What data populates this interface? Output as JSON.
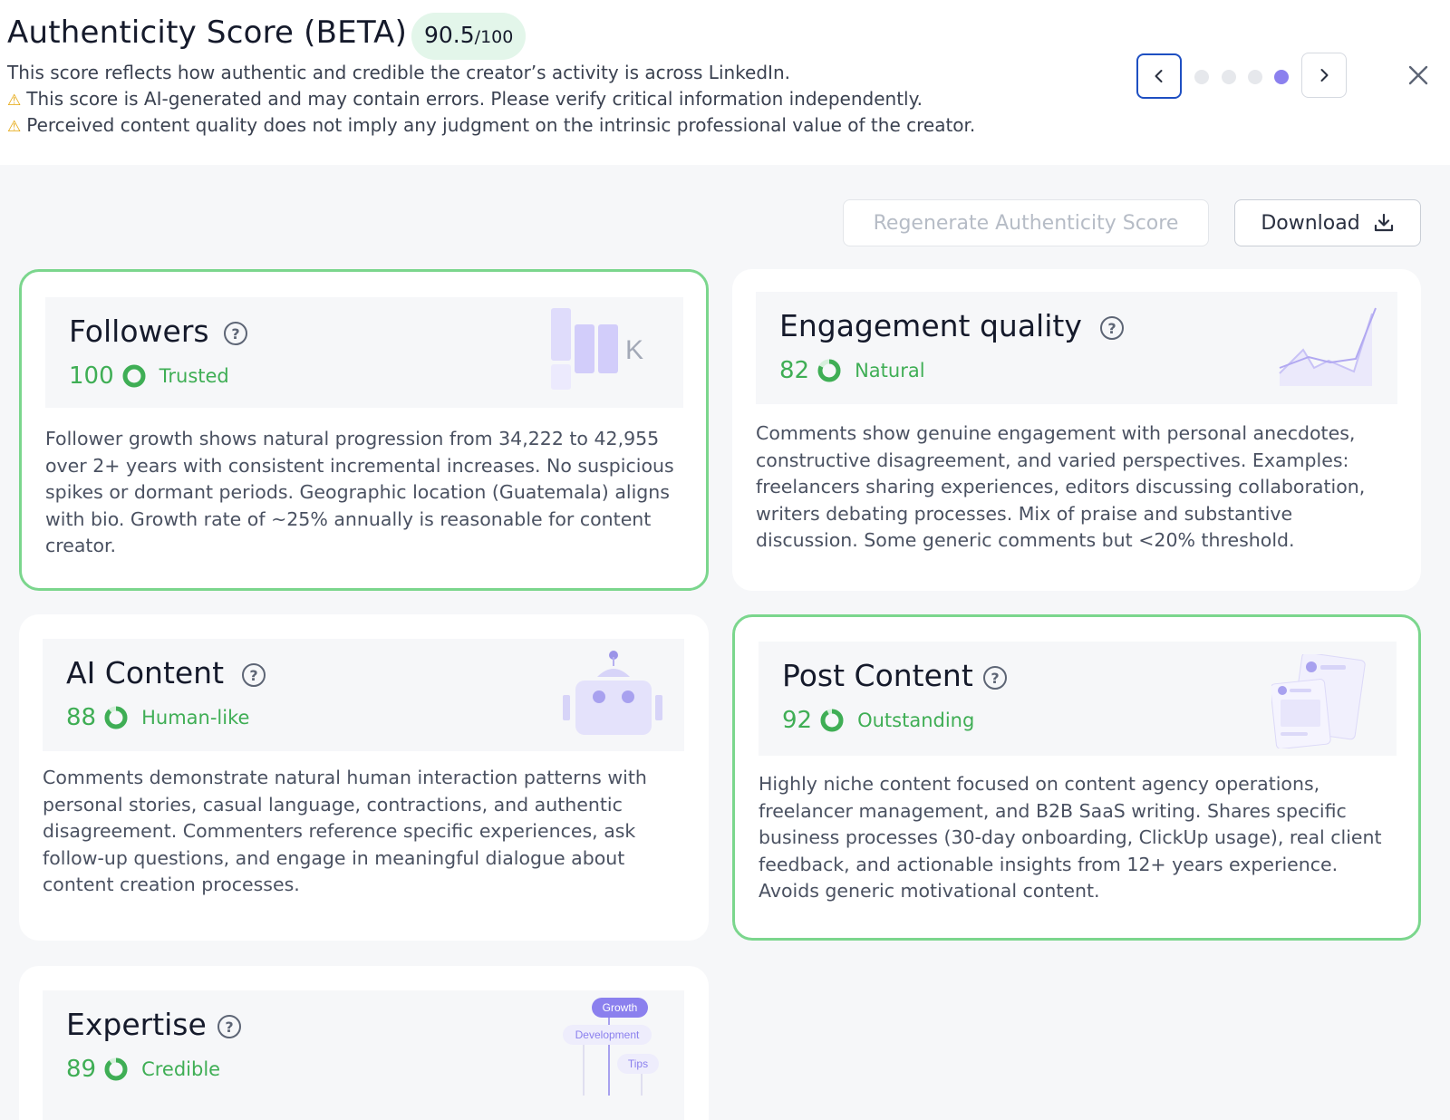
{
  "header": {
    "title": "Authenticity Score (BETA)",
    "score": "90.5",
    "score_max": "/100",
    "line1": "This score reflects how authentic and credible the creator’s activity is across LinkedIn.",
    "line2": "This score is AI-generated and may contain errors. Please verify critical information independently.",
    "line3": "Perceived content quality does not imply any judgment on the intrinsic professional value of the creator.",
    "pagination": {
      "total": 4,
      "active": 4
    }
  },
  "actions": {
    "regenerate_label": "Regenerate Authenticity Score",
    "download_label": "Download"
  },
  "cards": [
    {
      "title": "Followers",
      "score": "100",
      "score_value": 100,
      "label": "Trusted",
      "illustration_letter": "K",
      "description": "Follower growth shows natural progression from 34,222 to 42,955 over 2+ years with consistent incremental increases. No suspicious spikes or dormant periods. Geographic location (Guatemala) aligns with bio. Growth rate of ~25% annually is reasonable for content creator."
    },
    {
      "title": "Engagement quality",
      "score": "82",
      "score_value": 82,
      "label": "Natural",
      "description": "Comments show genuine engagement with personal anecdotes, constructive disagreement, and varied perspectives. Examples: freelancers sharing experiences, editors discussing collaboration, writers debating processes. Mix of praise and substantive discussion. Some generic comments but <20% threshold."
    },
    {
      "title": "AI Content",
      "score": "88",
      "score_value": 88,
      "label": "Human-like",
      "description": "Comments demonstrate natural human interaction patterns with personal stories, casual language, contractions, and authentic disagreement. Commenters reference specific experiences, ask follow-up questions, and engage in meaningful dialogue about content creation processes."
    },
    {
      "title": "Post Content",
      "score": "92",
      "score_value": 92,
      "label": "Outstanding",
      "description": "Highly niche content focused on content agency operations, freelancer management, and B2B SaaS writing. Shares specific business processes (30-day onboarding, ClickUp usage), real client feedback, and actionable insights from 12+ years experience. Avoids generic motivational content."
    },
    {
      "title": "Expertise",
      "score": "89",
      "score_value": 89,
      "label": "Credible",
      "tags": [
        "Growth",
        "Development",
        "Tips"
      ],
      "description": ""
    }
  ],
  "colors": {
    "accent_green": "#3fae55",
    "highlight_border": "#7bd68d",
    "accent_purple": "#8b80ee",
    "nav_blue": "#1e4fc2"
  },
  "icons": [
    "warning-icon",
    "chevron-left-icon",
    "chevron-right-icon",
    "close-icon",
    "download-icon",
    "help-icon"
  ]
}
